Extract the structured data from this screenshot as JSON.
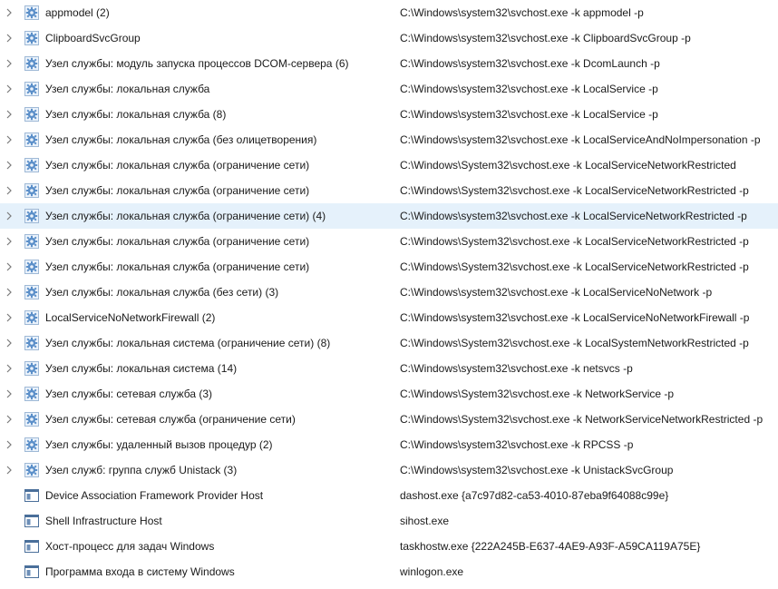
{
  "processes": [
    {
      "name": "appmodel (2)",
      "command": "C:\\Windows\\system32\\svchost.exe -k appmodel -p",
      "icon": "gear-icon",
      "expandable": true
    },
    {
      "name": "ClipboardSvcGroup",
      "command": "C:\\Windows\\system32\\svchost.exe -k ClipboardSvcGroup -p",
      "icon": "gear-icon",
      "expandable": true
    },
    {
      "name": "Узел службы: модуль запуска процессов DCOM-сервера (6)",
      "command": "C:\\Windows\\system32\\svchost.exe -k DcomLaunch -p",
      "icon": "gear-icon",
      "expandable": true
    },
    {
      "name": "Узел службы: локальная служба",
      "command": "C:\\Windows\\system32\\svchost.exe -k LocalService -p",
      "icon": "gear-icon",
      "expandable": true
    },
    {
      "name": "Узел службы: локальная служба (8)",
      "command": "C:\\Windows\\system32\\svchost.exe -k LocalService -p",
      "icon": "gear-icon",
      "expandable": true
    },
    {
      "name": "Узел службы: локальная служба (без олицетворения)",
      "command": "C:\\Windows\\system32\\svchost.exe -k LocalServiceAndNoImpersonation -p",
      "icon": "gear-icon",
      "expandable": true
    },
    {
      "name": "Узел службы: локальная служба (ограничение сети)",
      "command": "C:\\Windows\\System32\\svchost.exe -k LocalServiceNetworkRestricted",
      "icon": "gear-icon",
      "expandable": true
    },
    {
      "name": "Узел службы: локальная служба (ограничение сети)",
      "command": "C:\\Windows\\System32\\svchost.exe -k LocalServiceNetworkRestricted -p",
      "icon": "gear-icon",
      "expandable": true
    },
    {
      "name": "Узел службы: локальная служба (ограничение сети) (4)",
      "command": "C:\\Windows\\system32\\svchost.exe -k LocalServiceNetworkRestricted -p",
      "icon": "gear-icon",
      "expandable": true,
      "selected": true
    },
    {
      "name": "Узел службы: локальная служба (ограничение сети)",
      "command": "C:\\Windows\\System32\\svchost.exe -k LocalServiceNetworkRestricted -p",
      "icon": "gear-icon",
      "expandable": true
    },
    {
      "name": "Узел службы: локальная служба (ограничение сети)",
      "command": "C:\\Windows\\System32\\svchost.exe -k LocalServiceNetworkRestricted -p",
      "icon": "gear-icon",
      "expandable": true
    },
    {
      "name": "Узел службы: локальная служба (без сети) (3)",
      "command": "C:\\Windows\\system32\\svchost.exe -k LocalServiceNoNetwork -p",
      "icon": "gear-icon",
      "expandable": true
    },
    {
      "name": "LocalServiceNoNetworkFirewall (2)",
      "command": "C:\\Windows\\system32\\svchost.exe -k LocalServiceNoNetworkFirewall -p",
      "icon": "gear-icon",
      "expandable": true
    },
    {
      "name": "Узел службы: локальная система (ограничение сети) (8)",
      "command": "C:\\Windows\\System32\\svchost.exe -k LocalSystemNetworkRestricted -p",
      "icon": "gear-icon",
      "expandable": true
    },
    {
      "name": "Узел службы: локальная система (14)",
      "command": "C:\\Windows\\system32\\svchost.exe -k netsvcs -p",
      "icon": "gear-icon",
      "expandable": true
    },
    {
      "name": "Узел службы: сетевая служба (3)",
      "command": "C:\\Windows\\System32\\svchost.exe -k NetworkService -p",
      "icon": "gear-icon",
      "expandable": true
    },
    {
      "name": "Узел службы: сетевая служба (ограничение сети)",
      "command": "C:\\Windows\\System32\\svchost.exe -k NetworkServiceNetworkRestricted -p",
      "icon": "gear-icon",
      "expandable": true
    },
    {
      "name": "Узел службы: удаленный вызов процедур (2)",
      "command": "C:\\Windows\\system32\\svchost.exe -k RPCSS -p",
      "icon": "gear-icon",
      "expandable": true
    },
    {
      "name": "Узел служб: группа служб Unistack (3)",
      "command": "C:\\Windows\\system32\\svchost.exe -k UnistackSvcGroup",
      "icon": "gear-icon",
      "expandable": true
    },
    {
      "name": "Device Association Framework Provider Host",
      "command": "dashost.exe {a7c97d82-ca53-4010-87eba9f64088c99e}",
      "icon": "window-icon",
      "expandable": false
    },
    {
      "name": "Shell Infrastructure Host",
      "command": "sihost.exe",
      "icon": "window-icon",
      "expandable": false
    },
    {
      "name": "Хост-процесс для задач Windows",
      "command": "taskhostw.exe {222A245B-E637-4AE9-A93F-A59CA119A75E}",
      "icon": "window-icon",
      "expandable": false
    },
    {
      "name": "Программа входа в систему Windows",
      "command": "winlogon.exe",
      "icon": "window-icon",
      "expandable": false
    }
  ],
  "colors": {
    "selected_bg": "#e5f1fb",
    "gear_blue": "#5b8fc9",
    "text": "#1a1a1a",
    "chevron": "#7a7a7a"
  }
}
